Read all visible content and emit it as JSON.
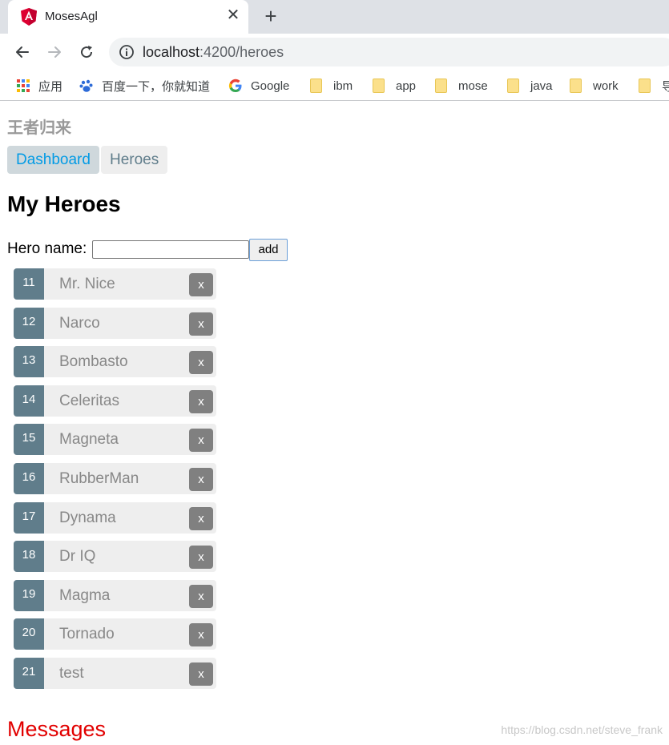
{
  "browser": {
    "tab_title": "MosesAgl",
    "close_symbol": "✕",
    "new_tab_symbol": "+",
    "url_host": "localhost",
    "url_rest": ":4200/heroes",
    "bookmarks": [
      {
        "label": "应用",
        "icon": "apps-grid-icon"
      },
      {
        "label": "百度一下，你就知道",
        "icon": "baidu-paw-icon"
      },
      {
        "label": "Google",
        "icon": "google-icon"
      },
      {
        "label": "ibm",
        "icon": "folder-icon"
      },
      {
        "label": "app",
        "icon": "folder-icon"
      },
      {
        "label": "mose",
        "icon": "folder-icon"
      },
      {
        "label": "java",
        "icon": "folder-icon"
      },
      {
        "label": "work",
        "icon": "folder-icon"
      },
      {
        "label": "导",
        "icon": "folder-icon"
      }
    ]
  },
  "app": {
    "title": "王者归来",
    "nav": [
      {
        "label": "Dashboard",
        "active": true
      },
      {
        "label": "Heroes",
        "active": false
      }
    ]
  },
  "page": {
    "heading": "My Heroes",
    "form": {
      "label": "Hero name:",
      "input_value": "",
      "add_label": "add"
    },
    "heroes": [
      {
        "id": "11",
        "name": "Mr. Nice",
        "delete_label": "x"
      },
      {
        "id": "12",
        "name": "Narco",
        "delete_label": "x"
      },
      {
        "id": "13",
        "name": "Bombasto",
        "delete_label": "x"
      },
      {
        "id": "14",
        "name": "Celeritas",
        "delete_label": "x"
      },
      {
        "id": "15",
        "name": "Magneta",
        "delete_label": "x"
      },
      {
        "id": "16",
        "name": "RubberMan",
        "delete_label": "x"
      },
      {
        "id": "17",
        "name": "Dynama",
        "delete_label": "x"
      },
      {
        "id": "18",
        "name": "Dr IQ",
        "delete_label": "x"
      },
      {
        "id": "19",
        "name": "Magma",
        "delete_label": "x"
      },
      {
        "id": "20",
        "name": "Tornado",
        "delete_label": "x"
      },
      {
        "id": "21",
        "name": "test",
        "delete_label": "x"
      }
    ],
    "messages_heading": "Messages"
  },
  "watermark": "https://blog.csdn.net/steve_frank",
  "colors": {
    "badge": "#607d8b",
    "active_link": "#039be5",
    "messages": "#e20000",
    "angular_red": "#dd0031"
  }
}
